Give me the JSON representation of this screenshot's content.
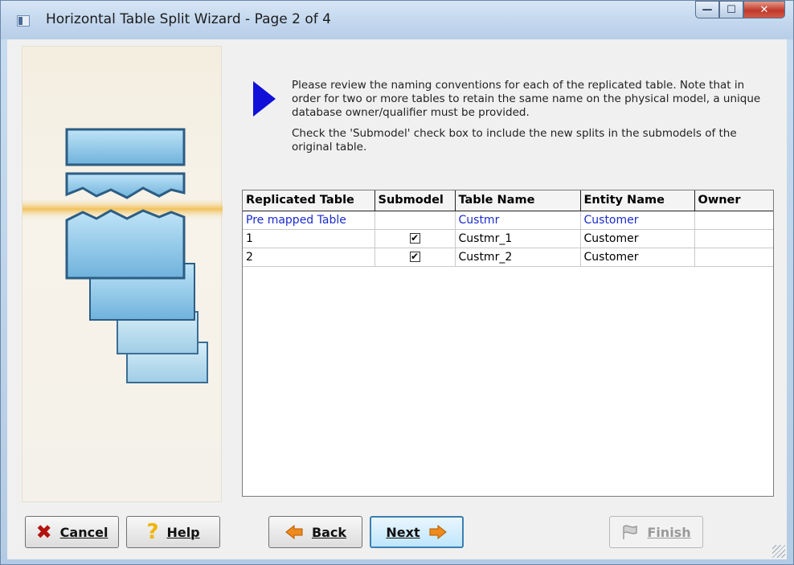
{
  "window": {
    "title": "Horizontal Table Split Wizard - Page 2 of 4",
    "buttons": {
      "minimize": "—",
      "maximize": "☐",
      "close": "✕"
    }
  },
  "instructions": {
    "paragraph1": "Please review the naming conventions for each of the replicated table. Note that in order for two or more tables to retain the same name on the physical model, a unique database owner/qualifier must be provided.",
    "paragraph2": "Check the 'Submodel' check box to include the new splits in the submodels of the original table."
  },
  "grid": {
    "columns": [
      "Replicated Table",
      "Submodel",
      "Table Name",
      "Entity Name",
      "Owner"
    ],
    "rows": [
      {
        "replicated_table": "Pre mapped Table",
        "submodel": null,
        "table_name": "Custmr",
        "entity_name": "Customer",
        "owner": ""
      },
      {
        "replicated_table": "1",
        "submodel": true,
        "table_name": "Custmr_1",
        "entity_name": "Customer",
        "owner": ""
      },
      {
        "replicated_table": "2",
        "submodel": true,
        "table_name": "Custmr_2",
        "entity_name": "Customer",
        "owner": ""
      }
    ],
    "colors": {
      "premapped_text": "#1a2ad0"
    }
  },
  "buttons": {
    "cancel": "Cancel",
    "help": "Help",
    "back": "Back",
    "next": "Next",
    "finish": "Finish"
  },
  "icons": {
    "cancel": "x-icon",
    "help": "question-icon",
    "back": "arrow-left-icon",
    "next": "arrow-right-icon",
    "finish": "flag-icon",
    "pointer": "triangle-right-icon"
  }
}
